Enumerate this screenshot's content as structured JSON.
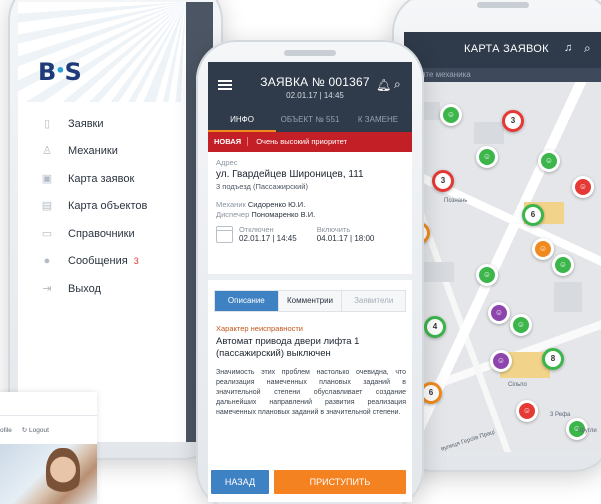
{
  "logo": {
    "b": "B",
    "s": "S"
  },
  "menu": {
    "items": [
      {
        "label": "Заявки",
        "icon": "document-icon"
      },
      {
        "label": "Механики",
        "icon": "worker-icon"
      },
      {
        "label": "Карта заявок",
        "icon": "map-icon"
      },
      {
        "label": "Карта объектов",
        "icon": "building-icon"
      },
      {
        "label": "Справочники",
        "icon": "book-icon"
      },
      {
        "label": "Сообщения",
        "icon": "chat-icon",
        "badge": "3"
      },
      {
        "label": "Выход",
        "icon": "exit-icon"
      }
    ]
  },
  "map_screen": {
    "title": "КАРТА ЗАЯВОК",
    "mechanic_placeholder": "ерите механика",
    "pins": [
      "3",
      "3",
      "6",
      "6",
      "4",
      "8",
      "6",
      "5"
    ],
    "labels": {
      "poznan": "Познань",
      "silpo": "Сільпо",
      "refa": "3 Рефа",
      "krug": "Кругли",
      "street": "вулиця Героїв Праці"
    }
  },
  "request": {
    "title": "ЗАЯВКА № 001367",
    "date": "02.01.17  |  14:45",
    "tabs": [
      "ИНФО",
      "ОБЪЕКТ № 551",
      "К ЗАМЕНЕ"
    ],
    "status_new": "НОВАЯ",
    "priority": "Очень высокий приоритет",
    "address_label": "Адрес",
    "address": "ул. Гвардейцев Широницев, 111",
    "address_detail": "3 подъезд (Пассажирский)",
    "mechanic_key": "Механик",
    "mechanic_value": "Сидоренко Ю.И.",
    "dispatcher_key": "Диспечер",
    "dispatcher_value": "Пономаренко В.И.",
    "off_label": "Отключен",
    "off_value": "02.01.17  |  14:45",
    "on_label": "Включить",
    "on_value": "04.01.17  |  18:00",
    "sub_tabs": [
      "Описание",
      "Комментрии",
      "Заявители"
    ],
    "fault_label": "Характер неисправности",
    "fault_title": "Автомат привода двери лифта 1 (пассажирский) выключен",
    "fault_text": "Значимость этих проблем настолько очевидна, что реализация намеченных плановых заданий в значительной степени обуславливает создание дальнейших направлений развития реализация намеченных плановых заданий в значительной степени.",
    "back_button": "НАЗАД",
    "start_button": "ПРИСТУПИТЬ"
  },
  "web": {
    "profile": "ofile",
    "logout": "Logout"
  },
  "colors": {
    "header": "#2f3a4a",
    "accent_orange": "#f58220",
    "accent_blue": "#3f82c4",
    "alert_red": "#c21f26"
  }
}
